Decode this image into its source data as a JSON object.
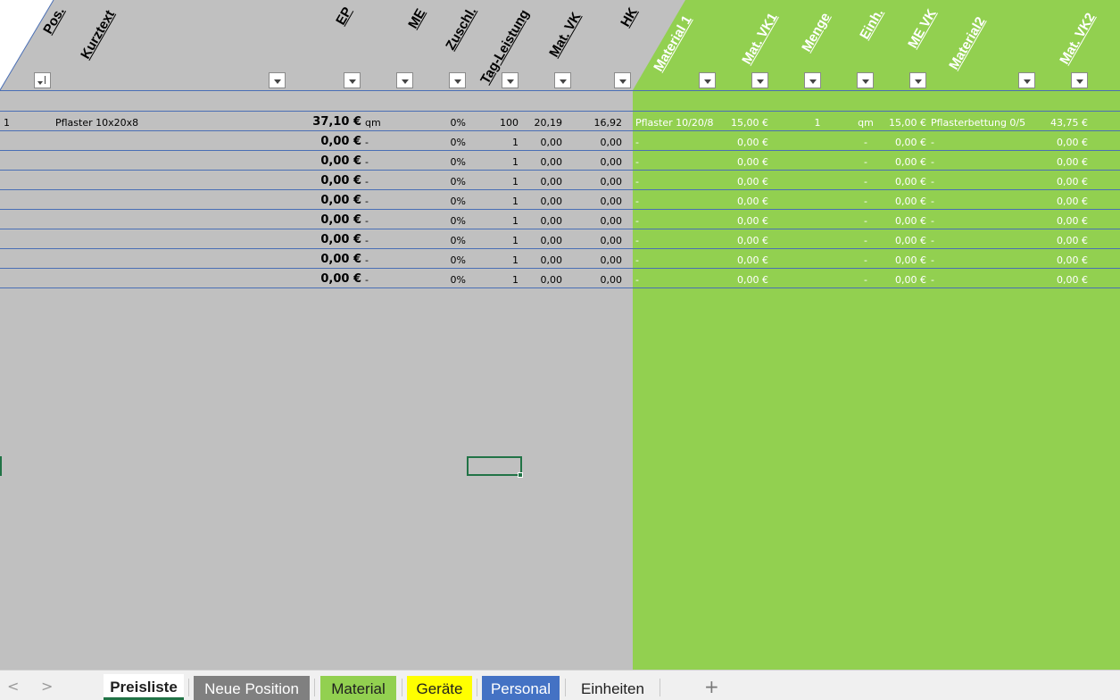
{
  "colors": {
    "grey_area": "#c0c0c0",
    "green_area": "#92d050",
    "row_line": "#4a6fb5",
    "selection": "#217346",
    "tab_neue_position": "#808080",
    "tab_material": "#92d050",
    "tab_geraete": "#ffff00",
    "tab_personal": "#4472c4"
  },
  "header": {
    "pos": "Pos.",
    "kurztext": "Kurztext",
    "ep": "EP",
    "me": "ME",
    "zuschl": "Zuschl.",
    "tag_leistung": "Tag-Leistung",
    "mat_vk": "Mat. VK",
    "hk": "HK",
    "material1": "Material 1",
    "mat_vk1": "Mat. VK1",
    "menge": "Menge",
    "einh": "Einh.",
    "me_vk": "ME VK",
    "material2": "Material2",
    "mat_vk2": "Mat. VK2"
  },
  "filter_icons": [
    "sort-filter-icon",
    "filter-dropdown-icon"
  ],
  "rows": [
    {
      "pos": "1",
      "kurztext": "Pflaster 10x20x8",
      "ep": "37,10 €",
      "me": "qm",
      "zuschl": "0%",
      "tag": "100",
      "matvk": "20,19",
      "hk": "16,92",
      "mat1": "Pflaster 10/20/8",
      "matvk1": "15,00 €",
      "menge": "1",
      "einh": "qm",
      "mevk": "15,00 €",
      "mat2": "Pflasterbettung 0/5",
      "matvk2": "43,75 €"
    },
    {
      "pos": "",
      "kurztext": "",
      "ep": "0,00 €",
      "me": "-",
      "zuschl": "0%",
      "tag": "1",
      "matvk": "0,00",
      "hk": "0,00",
      "mat1": "-",
      "matvk1": "0,00 €",
      "menge": "",
      "einh": "-",
      "mevk": "0,00 €",
      "mat2": "-",
      "matvk2": "0,00 €"
    },
    {
      "pos": "",
      "kurztext": "",
      "ep": "0,00 €",
      "me": "-",
      "zuschl": "0%",
      "tag": "1",
      "matvk": "0,00",
      "hk": "0,00",
      "mat1": "-",
      "matvk1": "0,00 €",
      "menge": "",
      "einh": "-",
      "mevk": "0,00 €",
      "mat2": "-",
      "matvk2": "0,00 €"
    },
    {
      "pos": "",
      "kurztext": "",
      "ep": "0,00 €",
      "me": "-",
      "zuschl": "0%",
      "tag": "1",
      "matvk": "0,00",
      "hk": "0,00",
      "mat1": "-",
      "matvk1": "0,00 €",
      "menge": "",
      "einh": "-",
      "mevk": "0,00 €",
      "mat2": "-",
      "matvk2": "0,00 €"
    },
    {
      "pos": "",
      "kurztext": "",
      "ep": "0,00 €",
      "me": "-",
      "zuschl": "0%",
      "tag": "1",
      "matvk": "0,00",
      "hk": "0,00",
      "mat1": "-",
      "matvk1": "0,00 €",
      "menge": "",
      "einh": "-",
      "mevk": "0,00 €",
      "mat2": "-",
      "matvk2": "0,00 €"
    },
    {
      "pos": "",
      "kurztext": "",
      "ep": "0,00 €",
      "me": "-",
      "zuschl": "0%",
      "tag": "1",
      "matvk": "0,00",
      "hk": "0,00",
      "mat1": "-",
      "matvk1": "0,00 €",
      "menge": "",
      "einh": "-",
      "mevk": "0,00 €",
      "mat2": "-",
      "matvk2": "0,00 €"
    },
    {
      "pos": "",
      "kurztext": "",
      "ep": "0,00 €",
      "me": "-",
      "zuschl": "0%",
      "tag": "1",
      "matvk": "0,00",
      "hk": "0,00",
      "mat1": "-",
      "matvk1": "0,00 €",
      "menge": "",
      "einh": "-",
      "mevk": "0,00 €",
      "mat2": "-",
      "matvk2": "0,00 €"
    },
    {
      "pos": "",
      "kurztext": "",
      "ep": "0,00 €",
      "me": "-",
      "zuschl": "0%",
      "tag": "1",
      "matvk": "0,00",
      "hk": "0,00",
      "mat1": "-",
      "matvk1": "0,00 €",
      "menge": "",
      "einh": "-",
      "mevk": "0,00 €",
      "mat2": "-",
      "matvk2": "0,00 €"
    },
    {
      "pos": "",
      "kurztext": "",
      "ep": "0,00 €",
      "me": "-",
      "zuschl": "0%",
      "tag": "1",
      "matvk": "0,00",
      "hk": "0,00",
      "mat1": "-",
      "matvk1": "0,00 €",
      "menge": "",
      "einh": "-",
      "mevk": "0,00 €",
      "mat2": "-",
      "matvk2": "0,00 €"
    }
  ],
  "tabs": {
    "nav_prev": "<",
    "nav_next": ">",
    "preisliste": "Preisliste",
    "neue_position": "Neue Position",
    "material": "Material",
    "geraete": "Geräte",
    "personal": "Personal",
    "einheiten": "Einheiten",
    "add": "+"
  }
}
